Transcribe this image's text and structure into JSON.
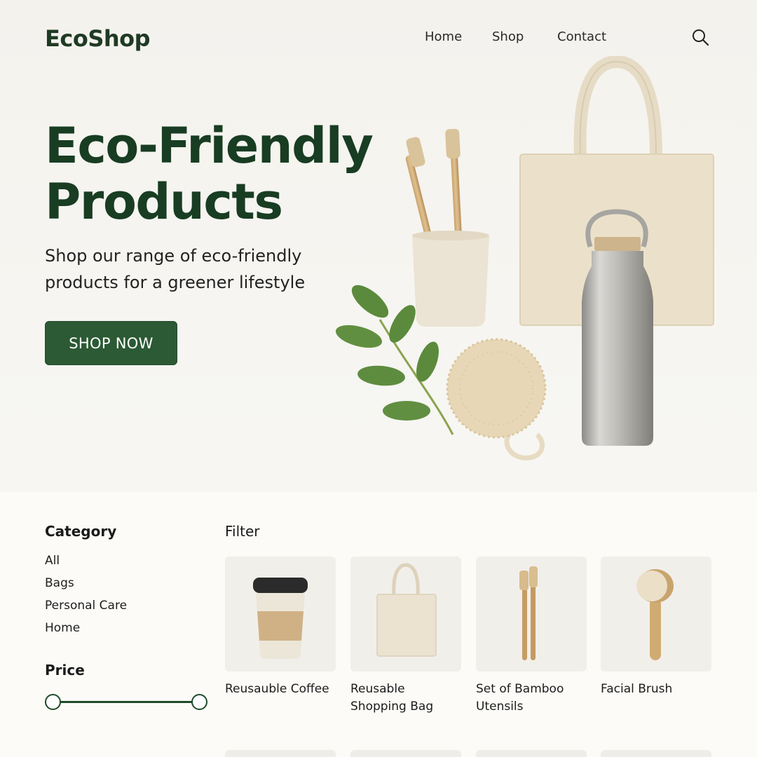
{
  "brand": {
    "name": "EcoShop",
    "accent": "#2b5a34",
    "title_color": "#183d22"
  },
  "nav": {
    "items": [
      {
        "label": "Home"
      },
      {
        "label": "Shop"
      },
      {
        "label": "Contact"
      }
    ],
    "search_icon": "search-icon"
  },
  "hero": {
    "title_lines": [
      "Eco-Friendly",
      "Products"
    ],
    "subtitle_lines": [
      "Shop our range of eco-friendly",
      "products for a greener lifestyle"
    ],
    "cta_label": "SHOP NOW"
  },
  "sidebar": {
    "category_heading": "Category",
    "categories": [
      "All",
      "Bags",
      "Personal Care",
      "Home"
    ],
    "price_heading": "Price",
    "price_range": {
      "min_fraction": 0,
      "max_fraction": 1
    }
  },
  "products": {
    "filter_label": "Filter",
    "items": [
      {
        "name": "Reusauble Coffee",
        "icon": "coffee-cup-icon"
      },
      {
        "name": "Reusable Shopping Bag",
        "icon": "tote-bag-icon"
      },
      {
        "name": "Set of Bamboo Utensils",
        "icon": "bamboo-utensils-icon"
      },
      {
        "name": "Facial Brush",
        "icon": "facial-brush-icon"
      }
    ]
  }
}
